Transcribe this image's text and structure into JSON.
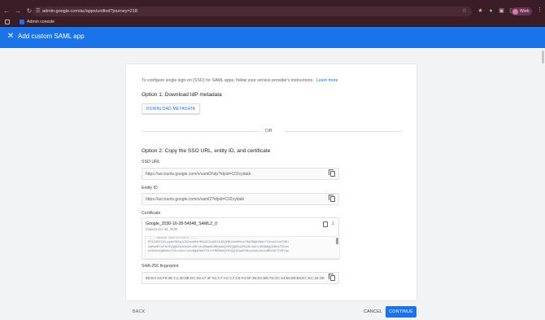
{
  "browser": {
    "url": "admin.google.com/ac/apps/unified?journey=218",
    "profile_label": "Work",
    "bookmark_label": "Admin console",
    "colors": {
      "chrome": "#3a1d26",
      "accent": "#1a73e8"
    }
  },
  "header": {
    "title": "Add custom SAML app",
    "close_icon": "close-icon"
  },
  "card": {
    "intro": "To configure single sign-on (SSO) for SAML apps, follow your service provider's instructions.",
    "learn_more": "Learn more",
    "option1_title": "Option 1: Download IdP metadata",
    "download_label": "DOWNLOAD METADATA",
    "or_label": "OR",
    "option2_title": "Option 2: Copy the SSO URL, entity ID, and certificate",
    "sso": {
      "label": "SSO URL",
      "value": "https://accounts.google.com/o/saml2/idp?idpid=C02cydatk"
    },
    "entity": {
      "label": "Entity ID",
      "value": "https://accounts.google.com/o/saml2?idpid=C02cydatk"
    },
    "certificate": {
      "label": "Certificate",
      "name": "Google_2030-10-28-54548_SAML2_0",
      "expires": "Expires Oct 28, 2030",
      "lines": [
        "-----BEGIN CERTIFICATE-----",
        "MIIDdDCCAlygAwIBAgIGAZvwAMzhMA0GCSqGSIb3DQEBCwUAMHsxFDASBgNVBAoTC0dvb2dsZSBJ",
        "bmMuMRYwFAYDVQQHEw1Nb3VudGFpbiBWaWV3MQ8wDQYDVQQDEwZHb29nbGUxGDAWBgNVBAsTD0dv",
        "b29nbGUgRm9yIFdvcmsxCzAJBgNVBAYTAlVTMRMwEQYDVQQIEwpDYWxpZm9ybmlhMB4XDTI1MTAy"
      ]
    },
    "fingerprint": {
      "label": "SHA-256 fingerprint",
      "value": "8D:E2:A5:F9:0E:C1:30:0B:DC:25:17:3F:51:C7:AC:C7:C8:F4:5F:35:DA:B8:7D:2C:44:59:99:B5:EC:EC:34:3D"
    }
  },
  "footer": {
    "back": "BACK",
    "cancel": "CANCEL",
    "continue": "CONTINUE"
  }
}
